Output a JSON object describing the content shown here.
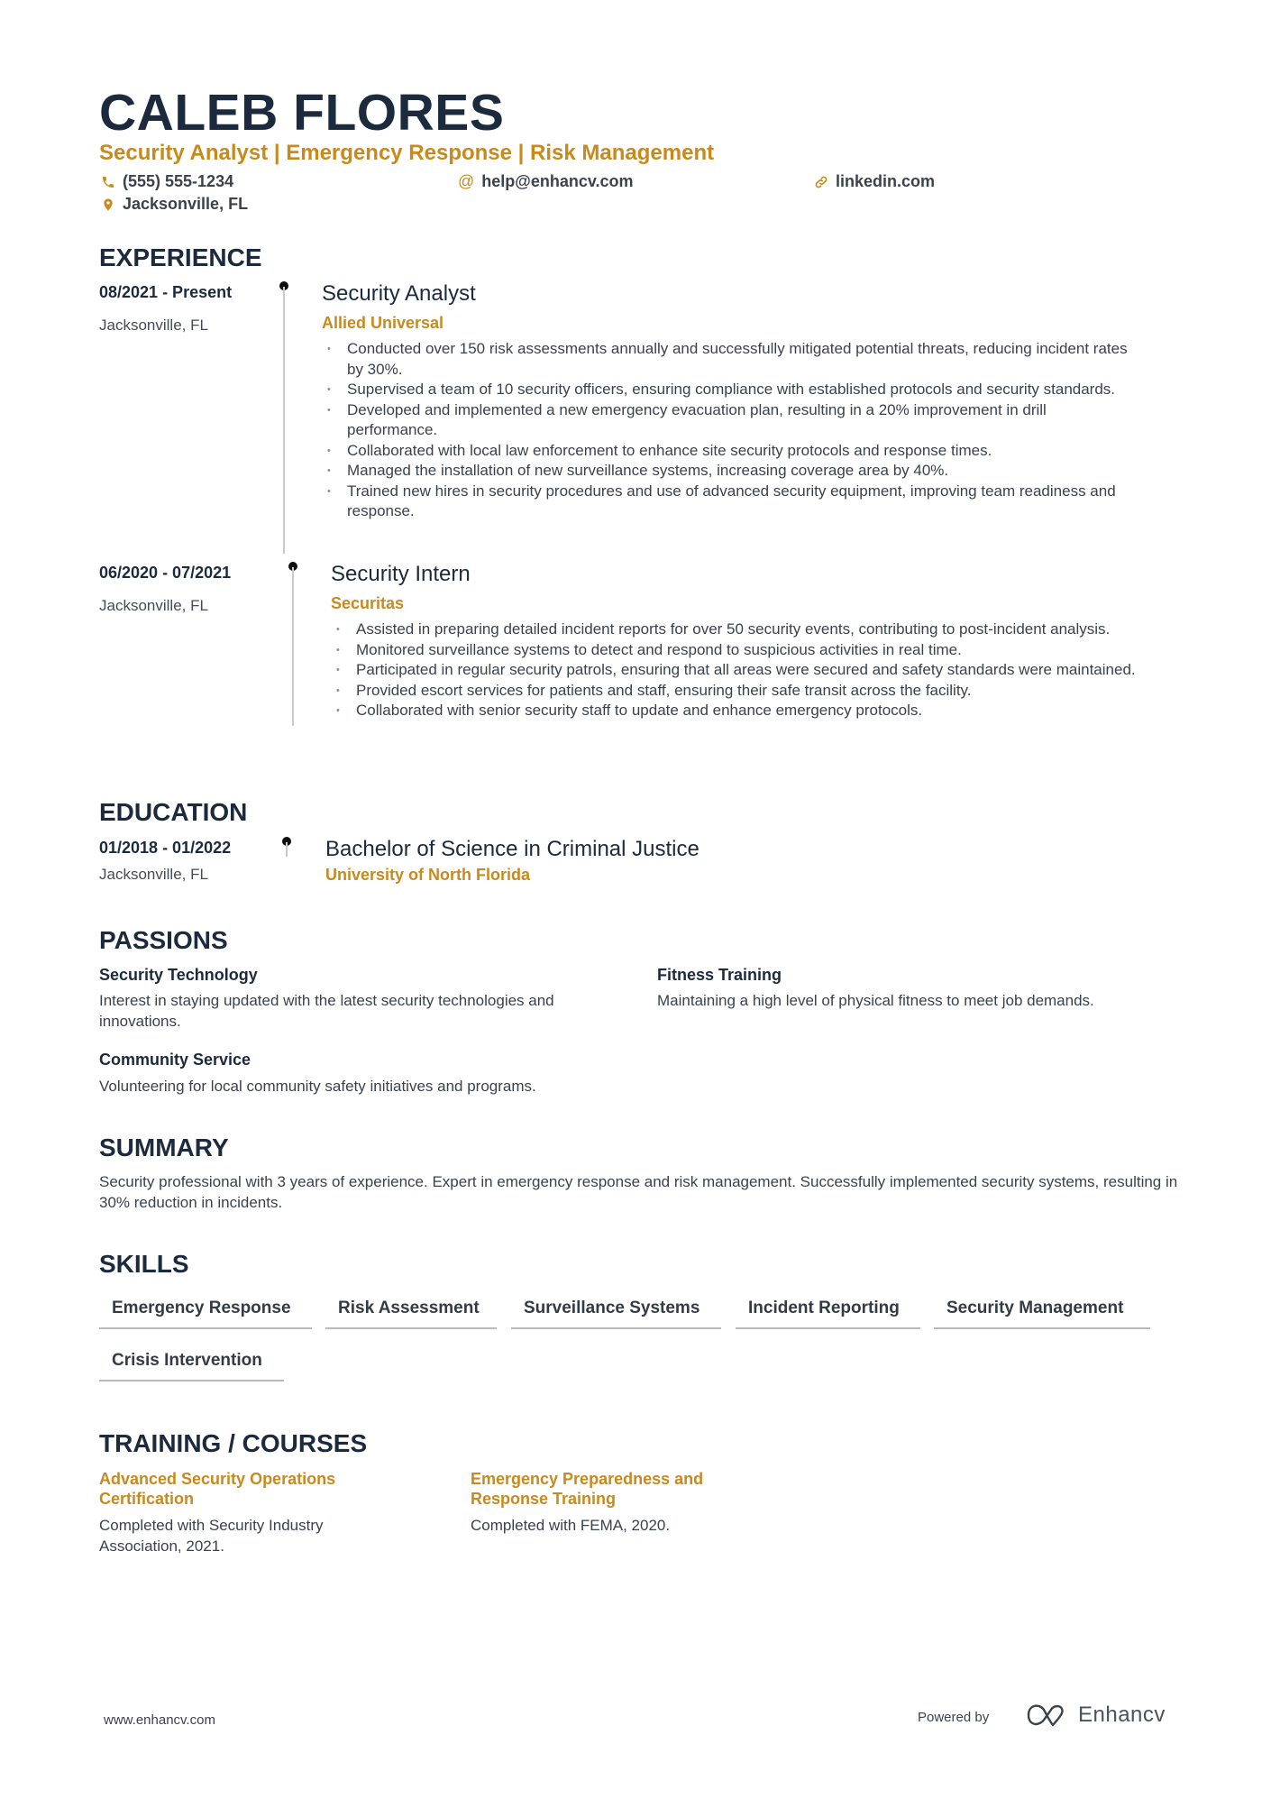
{
  "header": {
    "name": "CALEB FLORES",
    "headline": "Security Analyst | Emergency Response | Risk Management",
    "phone": "(555) 555-1234",
    "email": "help@enhancv.com",
    "linkedin": "linkedin.com",
    "location": "Jacksonville, FL"
  },
  "colors": {
    "accent": "#c8891d",
    "heading": "#1c2a3d",
    "text": "#3a424c"
  },
  "experience": {
    "title": "EXPERIENCE",
    "items": [
      {
        "date": "08/2021 - Present",
        "location": "Jacksonville, FL",
        "role": "Security Analyst",
        "company": "Allied Universal",
        "bullets": [
          "Conducted over 150 risk assessments annually and successfully mitigated potential threats, reducing incident rates by 30%.",
          "Supervised a team of 10 security officers, ensuring compliance with established protocols and security standards.",
          "Developed and implemented a new emergency evacuation plan, resulting in a 20% improvement in drill performance.",
          "Collaborated with local law enforcement to enhance site security protocols and response times.",
          "Managed the installation of new surveillance systems, increasing coverage area by 40%.",
          "Trained new hires in security procedures and use of advanced security equipment, improving team readiness and response."
        ]
      },
      {
        "date": "06/2020 - 07/2021",
        "location": "Jacksonville, FL",
        "role": "Security Intern",
        "company": "Securitas",
        "bullets": [
          "Assisted in preparing detailed incident reports for over 50 security events, contributing to post-incident analysis.",
          "Monitored surveillance systems to detect and respond to suspicious activities in real time.",
          "Participated in regular security patrols, ensuring that all areas were secured and safety standards were maintained.",
          "Provided escort services for patients and staff, ensuring their safe transit across the facility.",
          "Collaborated with senior security staff to update and enhance emergency protocols."
        ]
      }
    ]
  },
  "education": {
    "title": "EDUCATION",
    "items": [
      {
        "date": "01/2018 - 01/2022",
        "location": "Jacksonville, FL",
        "degree": "Bachelor of Science in Criminal Justice",
        "school": "University of North Florida"
      }
    ]
  },
  "passions": {
    "title": "PASSIONS",
    "items": [
      {
        "title": "Security Technology",
        "desc": "Interest in staying updated with the latest security technologies and innovations."
      },
      {
        "title": "Fitness Training",
        "desc": "Maintaining a high level of physical fitness to meet job demands."
      },
      {
        "title": "Community Service",
        "desc": "Volunteering for local community safety initiatives and programs."
      }
    ]
  },
  "summary": {
    "title": "SUMMARY",
    "text": "Security professional with 3 years of experience. Expert in emergency response and risk management. Successfully implemented security systems, resulting in 30% reduction in incidents."
  },
  "skills": {
    "title": "SKILLS",
    "items": [
      "Emergency Response",
      "Risk Assessment",
      "Surveillance Systems",
      "Incident Reporting",
      "Security Management",
      "Crisis Intervention"
    ]
  },
  "training": {
    "title": "TRAINING / COURSES",
    "items": [
      {
        "title": "Advanced Security Operations Certification",
        "desc": "Completed with Security Industry Association, 2021."
      },
      {
        "title": "Emergency Preparedness and Response Training",
        "desc": "Completed with FEMA, 2020."
      }
    ]
  },
  "footer": {
    "url": "www.enhancv.com",
    "powered_by": "Powered by",
    "brand": "Enhancv"
  }
}
